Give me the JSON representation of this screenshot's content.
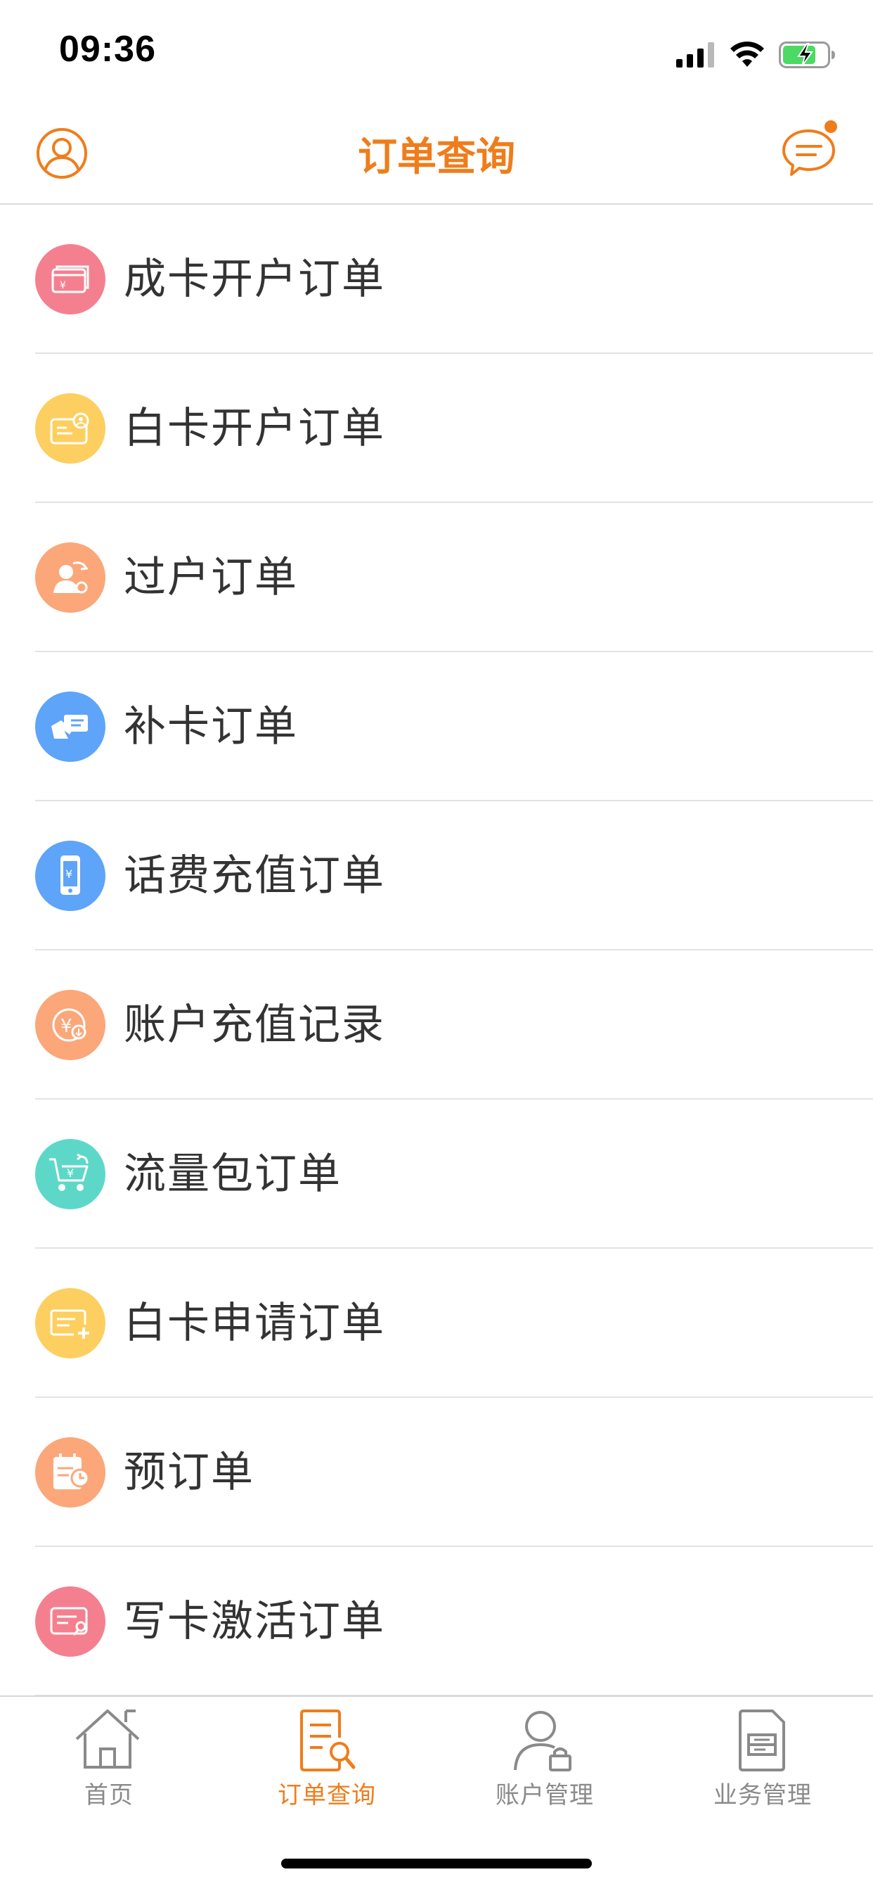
{
  "status_bar": {
    "time": "09:36"
  },
  "header": {
    "title": "订单查询"
  },
  "colors": {
    "accent": "#ef7d1b",
    "icon_pink": "#f4808f",
    "icon_yellow": "#fccf60",
    "icon_orange": "#fba77a",
    "icon_blue": "#5ea4f8",
    "icon_teal": "#5dd8c8"
  },
  "orders": [
    {
      "label": "成卡开户订单",
      "icon": "card-yuan-icon",
      "color": "#f4808f"
    },
    {
      "label": "白卡开户订单",
      "icon": "id-card-user-icon",
      "color": "#fccf60"
    },
    {
      "label": "过户订单",
      "icon": "transfer-user-icon",
      "color": "#fba77a"
    },
    {
      "label": "补卡订单",
      "icon": "hand-card-icon",
      "color": "#5ea4f8"
    },
    {
      "label": "话费充值订单",
      "icon": "phone-yuan-icon",
      "color": "#5ea4f8"
    },
    {
      "label": "账户充值记录",
      "icon": "coin-yuan-icon",
      "color": "#fba77a"
    },
    {
      "label": "流量包订单",
      "icon": "cart-yuan-icon",
      "color": "#5dd8c8"
    },
    {
      "label": "白卡申请订单",
      "icon": "card-add-icon",
      "color": "#fccf60"
    },
    {
      "label": "预订单",
      "icon": "calendar-clock-icon",
      "color": "#fba77a"
    },
    {
      "label": "写卡激活订单",
      "icon": "card-write-icon",
      "color": "#f4808f"
    }
  ],
  "tabs": [
    {
      "label": "首页",
      "icon": "home-icon"
    },
    {
      "label": "订单查询",
      "icon": "order-search-icon",
      "active": true
    },
    {
      "label": "账户管理",
      "icon": "account-lock-icon"
    },
    {
      "label": "业务管理",
      "icon": "document-icon"
    }
  ]
}
